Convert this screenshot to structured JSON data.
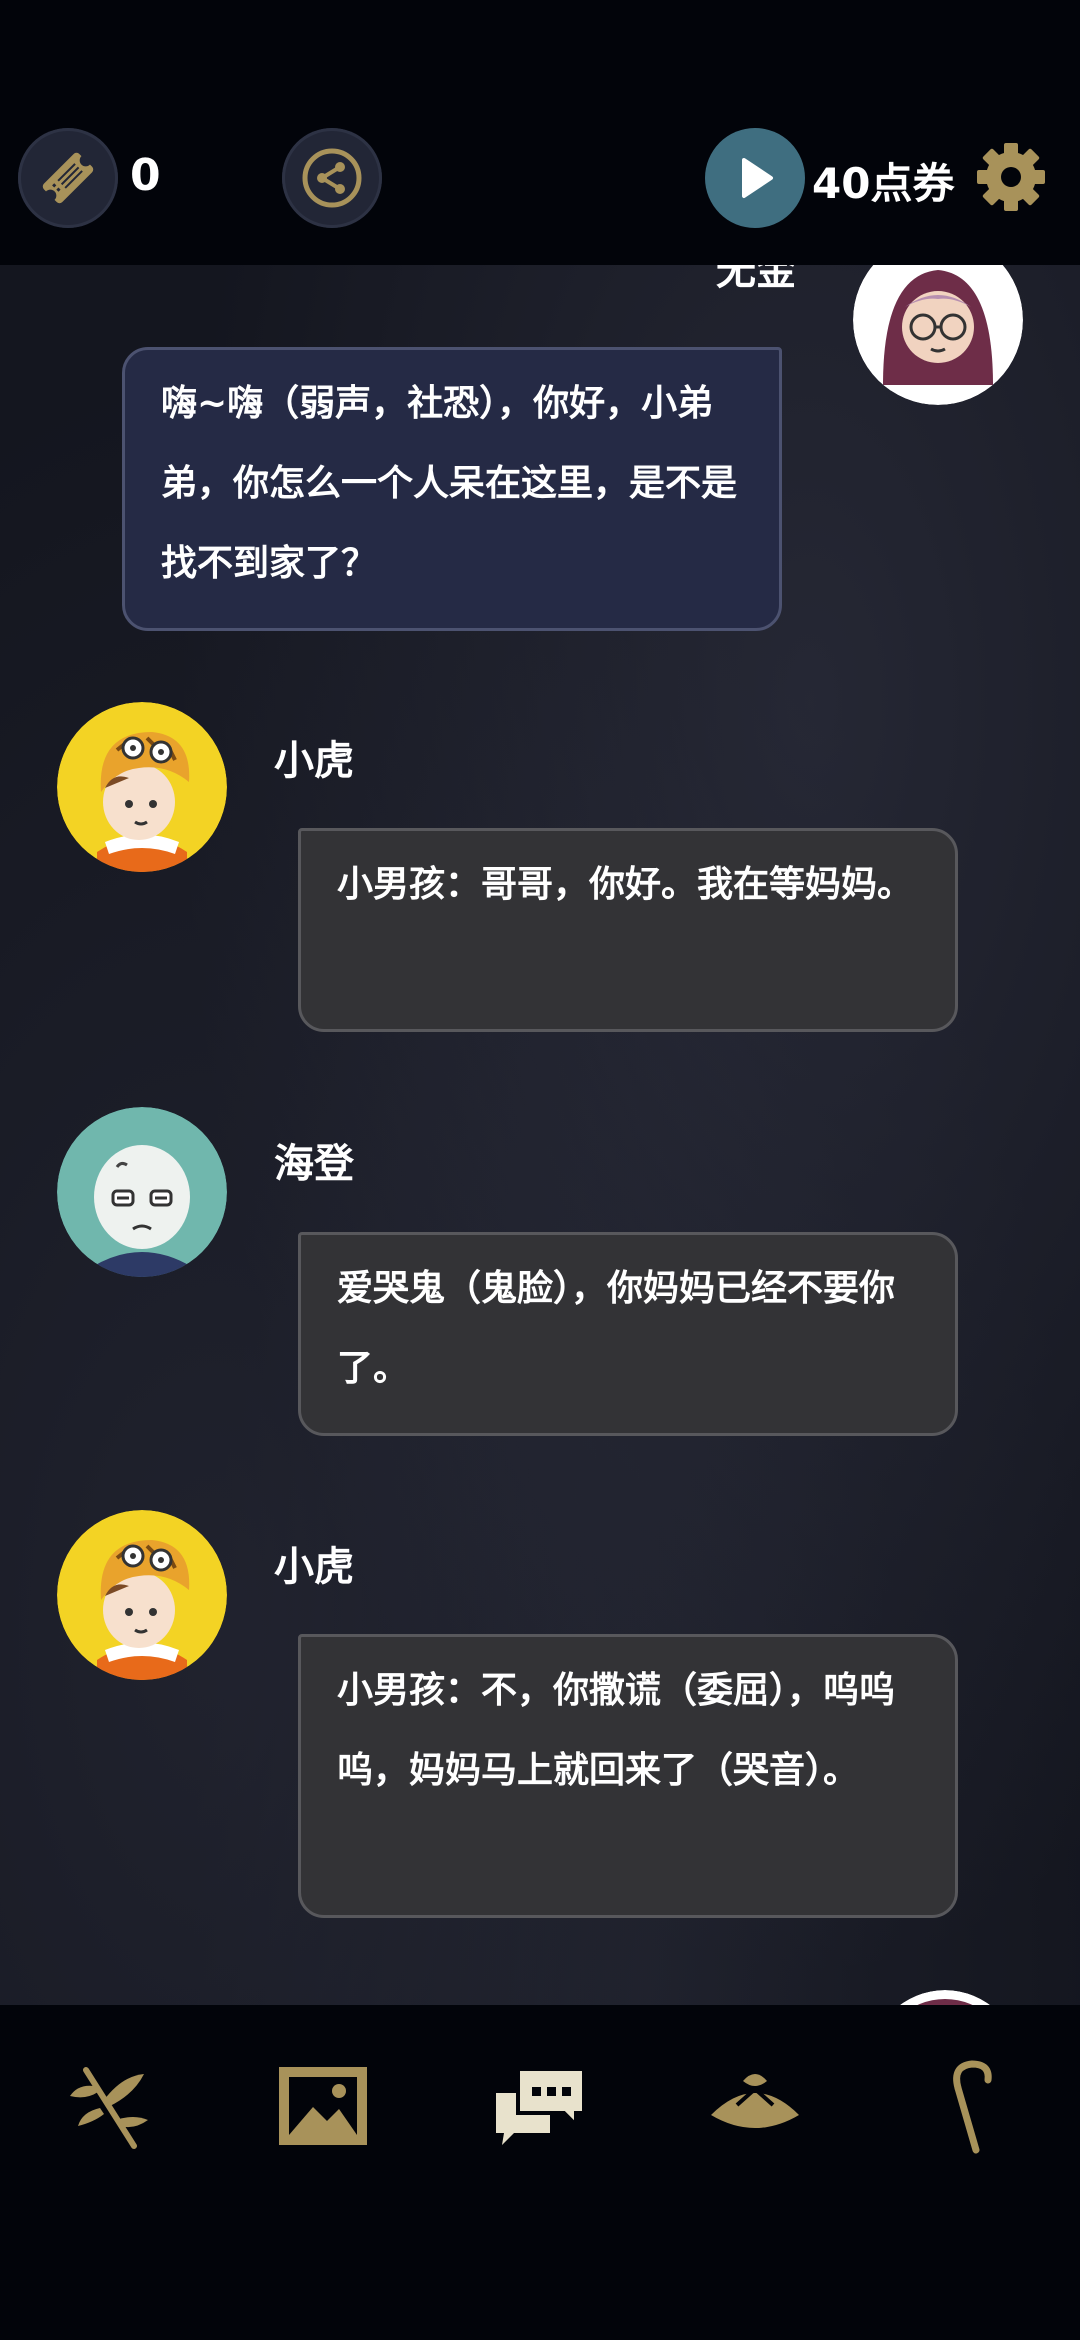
{
  "topbar": {
    "ticket_count": "0",
    "points_label": "40点券",
    "icons": [
      "ticket-icon",
      "share-icon",
      "play-icon",
      "gear-icon"
    ]
  },
  "chat": {
    "messages": [
      {
        "speaker": "无金",
        "side": "right",
        "avatar": "hooded-girl-with-glasses",
        "text": "嗨~嗨（弱声，社恐），你好，小弟弟，你怎么一个人呆在这里，是不是找不到家了？"
      },
      {
        "speaker": "小虎",
        "side": "left",
        "avatar": "boy-in-tiger-hat",
        "text": "小男孩：哥哥，你好。我在等妈妈。"
      },
      {
        "speaker": "海登",
        "side": "left",
        "avatar": "bald-boy-teal",
        "text": "爱哭鬼（鬼脸），你妈妈已经不要你了。"
      },
      {
        "speaker": "小虎",
        "side": "left",
        "avatar": "boy-in-tiger-hat",
        "text": "小男孩：不，你撒谎（委屈），呜呜呜，妈妈马上就回来了（哭音）。"
      }
    ]
  },
  "bottomnav": {
    "items": [
      "herb-branch-icon",
      "gallery-icon",
      "chat-log-icon",
      "hat-icon",
      "cane-icon"
    ],
    "active": "chat-log-icon"
  },
  "colors": {
    "accent_gold": "#a8925a",
    "active_icon": "#e8e2cc",
    "bubble_left": "#333336",
    "bubble_right": "#252a45",
    "play_button": "#3f6e80"
  }
}
